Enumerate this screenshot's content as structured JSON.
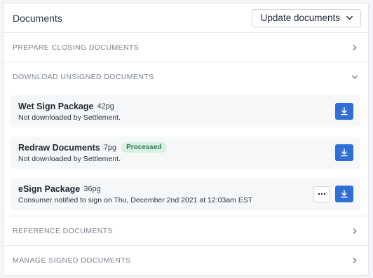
{
  "header": {
    "title": "Documents",
    "update_label": "Update documents"
  },
  "sections": [
    {
      "label": "PREPARE CLOSING DOCUMENTS",
      "expanded": false
    },
    {
      "label": "DOWNLOAD UNSIGNED DOCUMENTS",
      "expanded": true
    },
    {
      "label": "REFERENCE DOCUMENTS",
      "expanded": false
    },
    {
      "label": "MANAGE SIGNED DOCUMENTS",
      "expanded": false
    }
  ],
  "documents": [
    {
      "name": "Wet Sign Package",
      "pages": "42pg",
      "badge": "",
      "status": "Not downloaded by Settlement."
    },
    {
      "name": "Redraw Documents",
      "pages": "7pg",
      "badge": "Processed",
      "status": "Not downloaded by Settlement."
    },
    {
      "name": "eSign Package",
      "pages": "36pg",
      "badge": "",
      "status": "Consumer notified to sign on Thu, December 2nd 2021 at 12:03am EST"
    }
  ],
  "icons": {
    "download": "download-icon",
    "more": "more-horizontal-icon",
    "chevron_right": "chevron-right-icon",
    "chevron_down": "chevron-down-icon"
  },
  "colors": {
    "primary": "#2f6fd6",
    "badge_bg": "#d9f0e3",
    "badge_text": "#2d7a52"
  }
}
